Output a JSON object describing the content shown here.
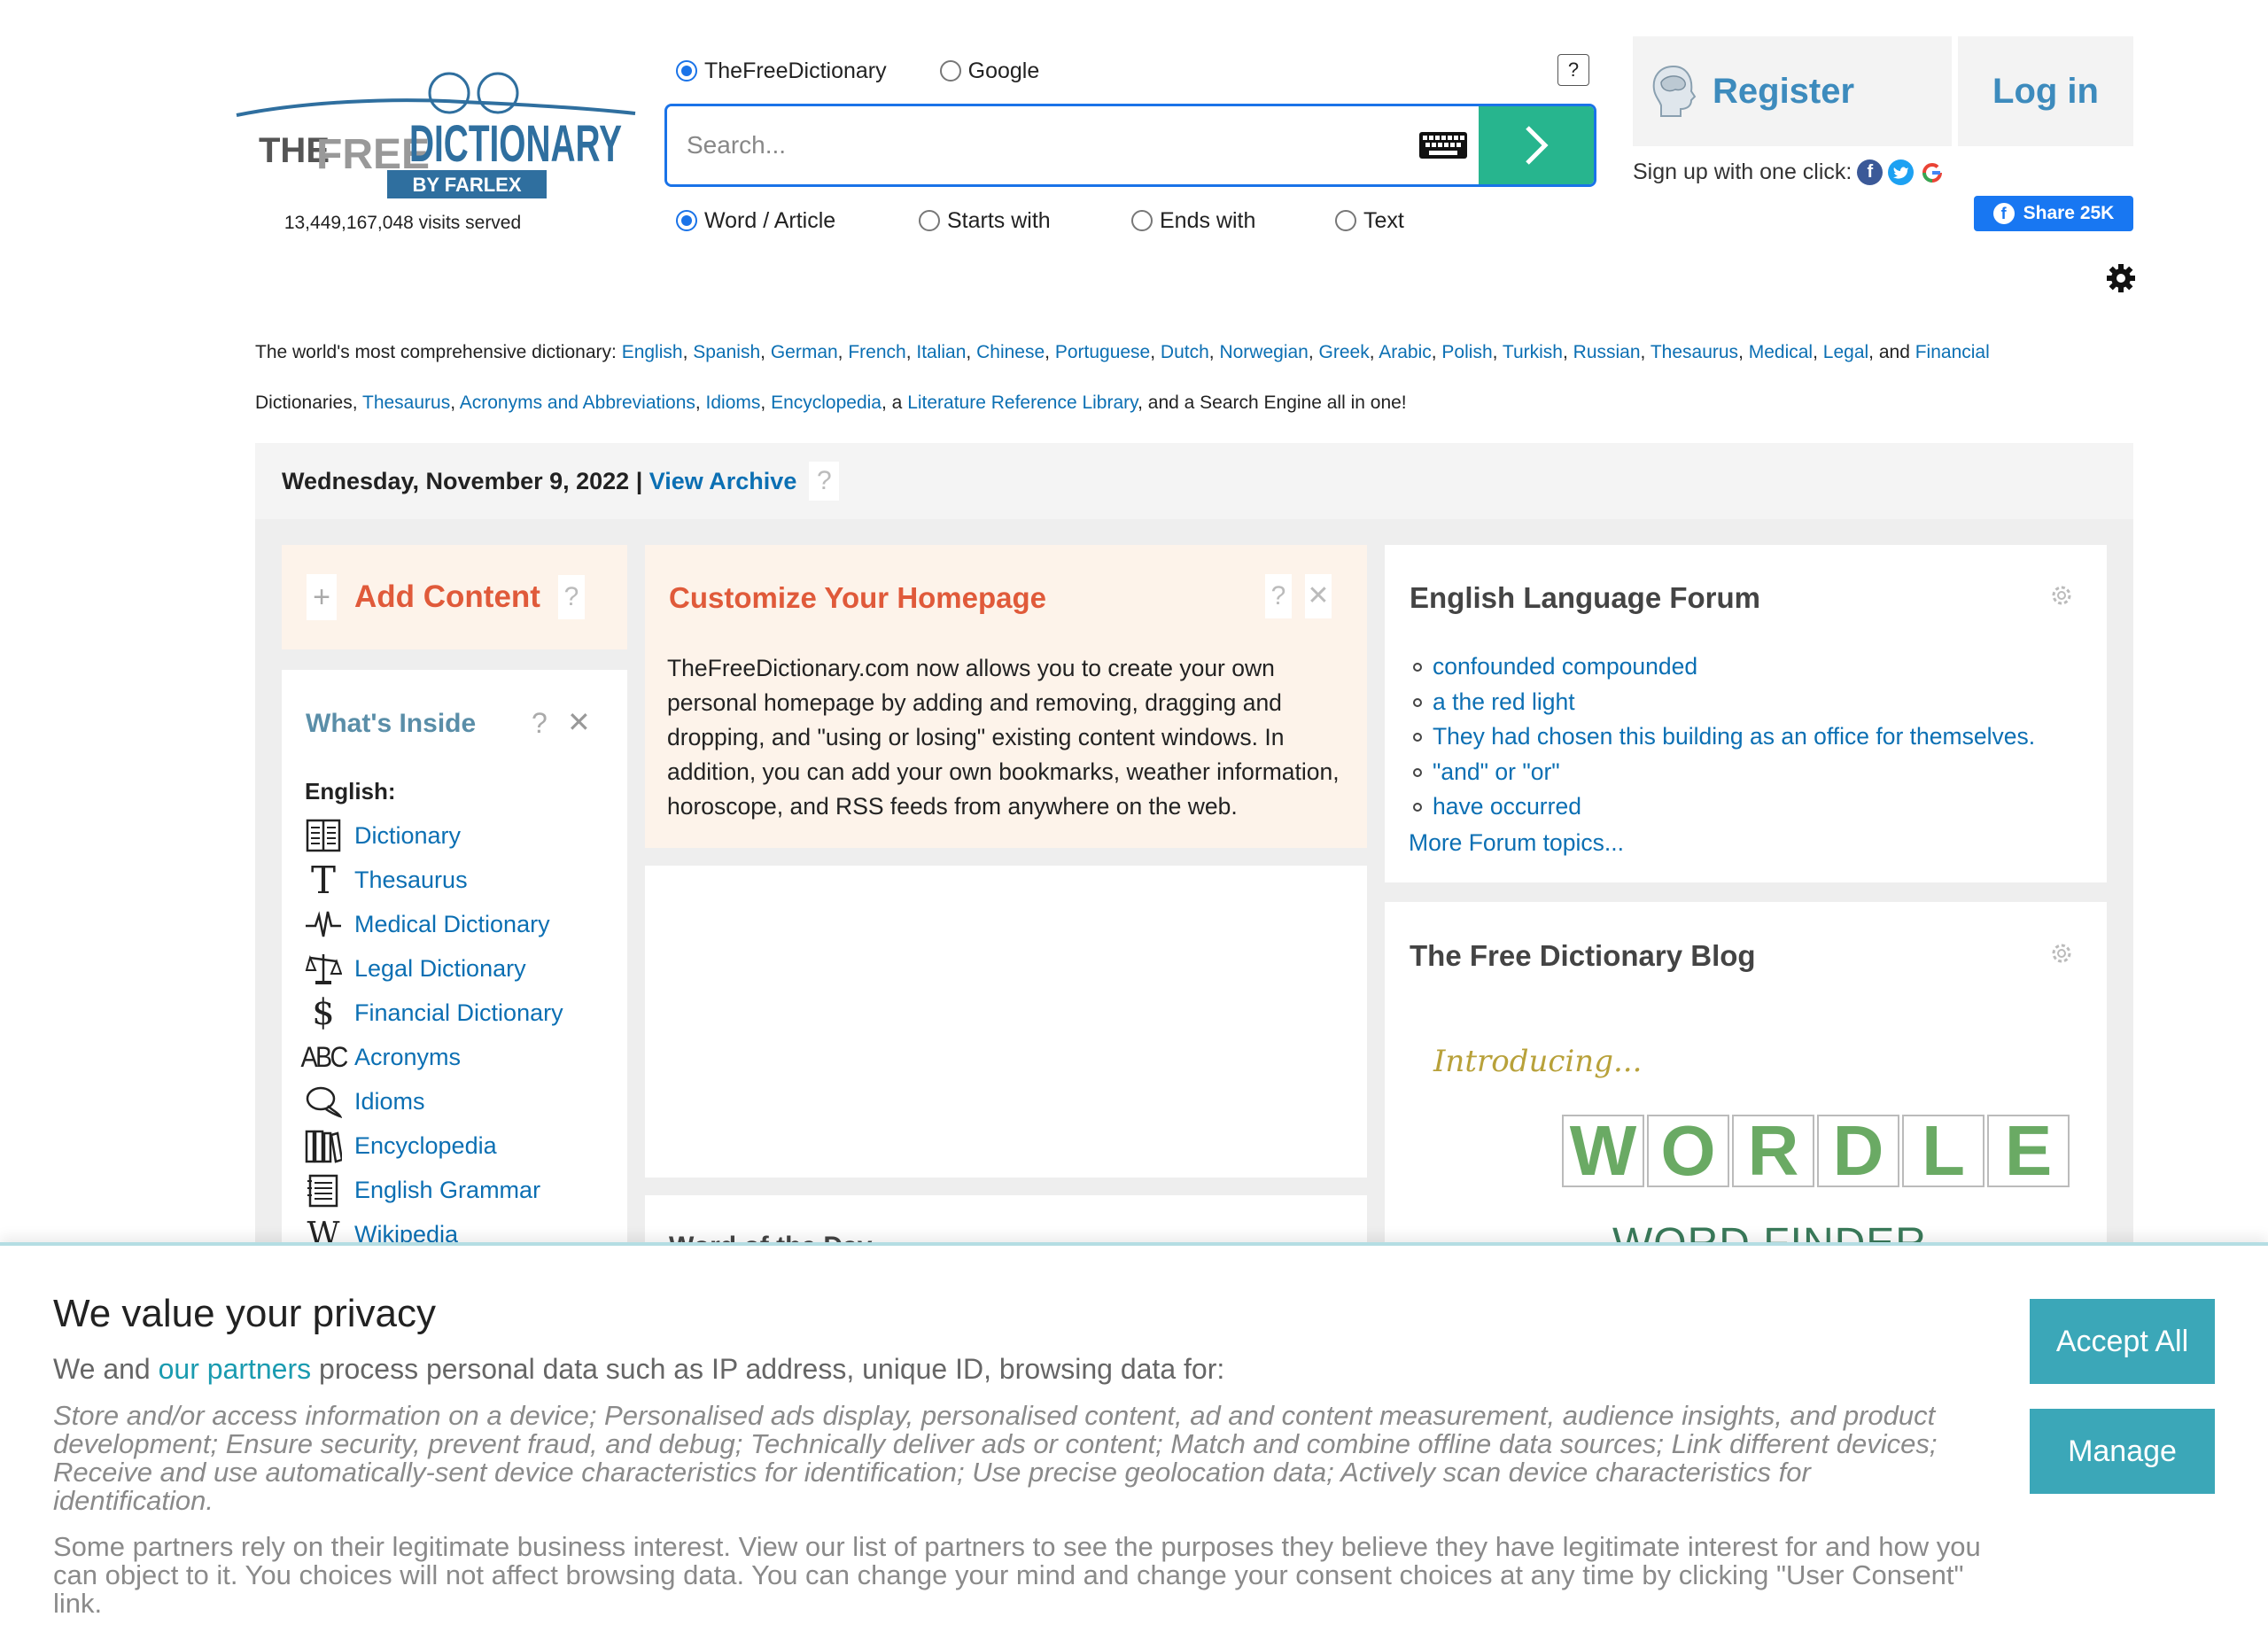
{
  "logo": {
    "the": "THE",
    "free": "FREE",
    "dictionary": "DICTIONARY",
    "by": "BY FARLEX"
  },
  "visits": "13,449,167,048 visits served",
  "search": {
    "sources": [
      {
        "label": "TheFreeDictionary",
        "selected": true
      },
      {
        "label": "Google",
        "selected": false
      }
    ],
    "help": "?",
    "placeholder": "Search...",
    "modes": [
      {
        "label": "Word / Article",
        "selected": true
      },
      {
        "label": "Starts with",
        "selected": false
      },
      {
        "label": "Ends with",
        "selected": false
      },
      {
        "label": "Text",
        "selected": false
      }
    ]
  },
  "account": {
    "register": "Register",
    "login": "Log in",
    "signup": "Sign up with one click:",
    "share": "Share 25K"
  },
  "tagline": {
    "prefix": "The world's most comprehensive dictionary: ",
    "links1": [
      "English",
      "Spanish",
      "German",
      "French",
      "Italian",
      "Chinese",
      "Portuguese",
      "Dutch",
      "Norwegian",
      "Greek",
      "Arabic",
      "Polish",
      "Turkish",
      "Russian",
      "Thesaurus",
      "Medical",
      "Legal"
    ],
    "and": ", and ",
    "financial": "Financial",
    "line2_start": "Dictionaries, ",
    "thesaurus": "Thesaurus",
    "acronyms": "Acronyms and Abbreviations",
    "idioms": "Idioms",
    "encyclopedia": "Encyclopedia",
    "a": ", a ",
    "literature": "Literature Reference Library",
    "end": ", and a Search Engine all in one!"
  },
  "datebar": {
    "date": "Wednesday, November 9, 2022",
    "sep": " | ",
    "archive": "View Archive",
    "help": "?"
  },
  "add_content": {
    "plus": "+",
    "title": "Add Content",
    "help": "?"
  },
  "whats_inside": {
    "title": "What's Inside",
    "help": "?",
    "close": "✕",
    "section": "English:",
    "items": [
      {
        "label": "Dictionary",
        "icon": "book-icon"
      },
      {
        "label": "Thesaurus",
        "icon": "thesaurus-t-icon"
      },
      {
        "label": "Medical Dictionary",
        "icon": "heartbeat-icon"
      },
      {
        "label": "Legal Dictionary",
        "icon": "scales-icon"
      },
      {
        "label": "Financial Dictionary",
        "icon": "dollar-icon"
      },
      {
        "label": "Acronyms",
        "icon": "abc-icon"
      },
      {
        "label": "Idioms",
        "icon": "speech-bubbles-icon"
      },
      {
        "label": "Encyclopedia",
        "icon": "books-icon"
      },
      {
        "label": "English Grammar",
        "icon": "notepad-icon"
      },
      {
        "label": "Wikipedia",
        "icon": "wikipedia-w-icon"
      }
    ]
  },
  "customize": {
    "title": "Customize Your Homepage",
    "help": "?",
    "close": "✕",
    "body": "TheFreeDictionary.com now allows you to create your own personal homepage by adding and removing, dragging and dropping, and \"using or losing\" existing content windows. In addition, you can add your own bookmarks, weather information, horoscope, and RSS feeds from anywhere on the web."
  },
  "wotd": {
    "title": "Word of the Day"
  },
  "forum": {
    "title": "English Language Forum",
    "topics": [
      "confounded compounded",
      "a the red light",
      "They had chosen this building as an office for themselves.",
      "\"and\" or \"or\"",
      "have occurred"
    ],
    "more": "More Forum topics..."
  },
  "blog": {
    "title": "The Free Dictionary Blog",
    "intro": "Introducing...",
    "wordle": [
      "W",
      "O",
      "R",
      "D",
      "L",
      "E"
    ],
    "sub": "WORD FINDER"
  },
  "consent": {
    "title": "We value your privacy",
    "lead_pre": "We and ",
    "lead_link": "our partners",
    "lead_post": " process personal data such as IP address, unique ID, browsing data for:",
    "purposes": "Store and/or access information on a device; Personalised ads display, personalised content, ad and content measurement, audience insights, and product development; Ensure security, prevent fraud, and debug; Technically deliver ads or content; Match and combine offline data sources; Link different devices; Receive and use automatically-sent device characteristics for identification; Use precise geolocation data; Actively scan device characteristics for identification.",
    "note": "Some partners rely on their legitimate business interest. View our list of partners to see the purposes they believe they have legitimate interest for and how you can object to it. You choices will not affect browsing data. You can change your mind and change your consent choices at any time by clicking \"User Consent\" link.",
    "accept": "Accept All",
    "manage": "Manage"
  },
  "colors": {
    "accent_blue": "#1a73e8",
    "search_go": "#27b58e",
    "orange_title": "#e05a3a",
    "consent_button": "#3ba7b8",
    "link": "#0b6fb3"
  }
}
